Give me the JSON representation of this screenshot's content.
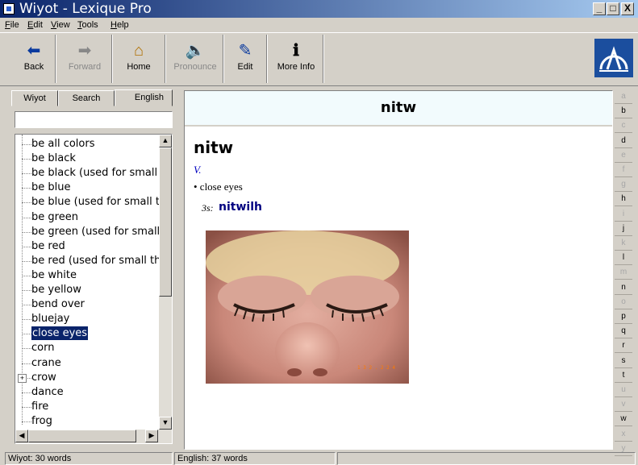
{
  "window": {
    "title": "Wiyot - Lexique Pro",
    "min": "_",
    "max": "□",
    "close": "X"
  },
  "menu": [
    "File",
    "Edit",
    "View",
    "Tools",
    "Help"
  ],
  "toolbar": {
    "back": "Back",
    "forward": "Forward",
    "home": "Home",
    "pronounce": "Pronounce",
    "edit": "Edit",
    "more_info": "More Info"
  },
  "tabs": [
    "Wiyot",
    "Search",
    "English"
  ],
  "search": {
    "value": "",
    "placeholder": ""
  },
  "words": [
    "be all colors",
    "be black",
    "be black (used for small",
    "be blue",
    "be blue (used for small t",
    "be green",
    "be green (used for small",
    "be red",
    "be red (used for small th",
    "be white",
    "be yellow",
    "bend over",
    "bluejay",
    "close eyes",
    "corn",
    "crane",
    "crow",
    "dance",
    "fire",
    "frog"
  ],
  "selected_word": "close eyes",
  "entry": {
    "headword": "nitw",
    "pos": "V.",
    "gloss": "• close eyes",
    "form_label": "3s:",
    "form_value": "nitwilh",
    "photo_stamp": "1 3 2 .   2 2 4"
  },
  "alphabet": [
    {
      "l": "a",
      "on": false
    },
    {
      "l": "b",
      "on": true
    },
    {
      "l": "c",
      "on": false
    },
    {
      "l": "d",
      "on": true
    },
    {
      "l": "e",
      "on": false
    },
    {
      "l": "f",
      "on": false
    },
    {
      "l": "g",
      "on": false
    },
    {
      "l": "h",
      "on": true
    },
    {
      "l": "i",
      "on": false
    },
    {
      "l": "j",
      "on": true
    },
    {
      "l": "k",
      "on": false
    },
    {
      "l": "l",
      "on": true
    },
    {
      "l": "m",
      "on": false
    },
    {
      "l": "n",
      "on": true
    },
    {
      "l": "o",
      "on": false
    },
    {
      "l": "p",
      "on": true
    },
    {
      "l": "q",
      "on": true
    },
    {
      "l": "r",
      "on": true
    },
    {
      "l": "s",
      "on": true
    },
    {
      "l": "t",
      "on": true
    },
    {
      "l": "u",
      "on": false
    },
    {
      "l": "v",
      "on": false
    },
    {
      "l": "w",
      "on": true
    },
    {
      "l": "x",
      "on": false
    },
    {
      "l": "y",
      "on": false
    }
  ],
  "status": {
    "left": "Wiyot: 30 words",
    "middle": "English: 37 words",
    "right": ""
  }
}
